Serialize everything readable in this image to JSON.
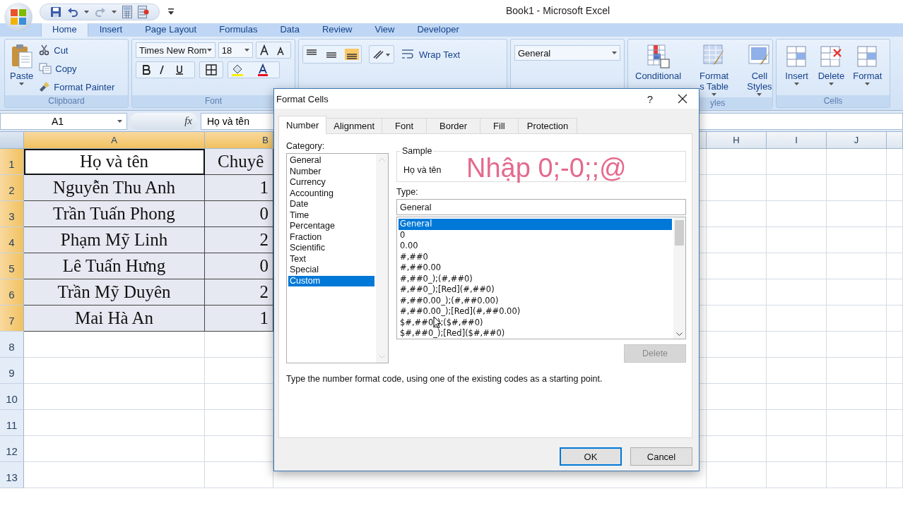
{
  "title_bar": {
    "title": "Book1 - Microsoft Excel"
  },
  "ribbon_tabs": [
    {
      "label": "Home",
      "selected": true
    },
    {
      "label": "Insert",
      "selected": false
    },
    {
      "label": "Page Layout",
      "selected": false
    },
    {
      "label": "Formulas",
      "selected": false
    },
    {
      "label": "Data",
      "selected": false
    },
    {
      "label": "Review",
      "selected": false
    },
    {
      "label": "View",
      "selected": false
    },
    {
      "label": "Developer",
      "selected": false
    }
  ],
  "ribbon": {
    "clipboard": {
      "paste": "Paste",
      "cut": "Cut",
      "copy": "Copy",
      "format_painter": "Format Painter",
      "label": "Clipboard"
    },
    "font": {
      "font_name": "Times New Rom",
      "font_size": "18",
      "label": "Font"
    },
    "alignment": {
      "wrap_text": "Wrap Text"
    },
    "number": {
      "format": "General"
    },
    "styles": {
      "conditional": "Conditional",
      "format_table": "Format",
      "format_table_2": "s Table",
      "cell_styles": "Cell",
      "cell_styles_2": "Styles",
      "label": "yles"
    },
    "cells": {
      "buttons": [
        "Insert",
        "Delete",
        "Format"
      ],
      "label": "Cells"
    }
  },
  "formula_bar": {
    "name_box": "A1",
    "function_label": "fx",
    "content": "Họ và tên"
  },
  "sheet": {
    "columns": [
      {
        "label": "A",
        "selected": true
      },
      {
        "label": "B",
        "selected": true
      },
      {
        "label": "H",
        "selected": false
      },
      {
        "label": "I",
        "selected": false
      },
      {
        "label": "J",
        "selected": false
      }
    ],
    "rows": [
      {
        "label": "1",
        "selected": true,
        "cells": [
          {
            "text": "Họ và tên",
            "active": true
          },
          {
            "text": "Chuyê",
            "active": false
          }
        ]
      },
      {
        "label": "2",
        "selected": true,
        "cells": [
          {
            "text": "Nguyễn Thu Anh",
            "active": false
          },
          {
            "text": "1",
            "active": false
          }
        ]
      },
      {
        "label": "3",
        "selected": true,
        "cells": [
          {
            "text": "Trần Tuấn Phong",
            "active": false
          },
          {
            "text": "0",
            "active": false
          }
        ]
      },
      {
        "label": "4",
        "selected": true,
        "cells": [
          {
            "text": "Phạm Mỹ Linh",
            "active": false
          },
          {
            "text": "2",
            "active": false
          }
        ]
      },
      {
        "label": "5",
        "selected": true,
        "cells": [
          {
            "text": "Lê Tuấn Hưng",
            "active": false
          },
          {
            "text": "0",
            "active": false
          }
        ]
      },
      {
        "label": "6",
        "selected": true,
        "cells": [
          {
            "text": "Trần Mỹ Duyên",
            "active": false
          },
          {
            "text": "2",
            "active": false
          }
        ]
      },
      {
        "label": "7",
        "selected": true,
        "cells": [
          {
            "text": "Mai Hà An",
            "active": false
          },
          {
            "text": "1",
            "active": false
          }
        ]
      },
      {
        "label": "8",
        "selected": false,
        "cells": []
      },
      {
        "label": "9",
        "selected": false,
        "cells": []
      },
      {
        "label": "10",
        "selected": false,
        "cells": []
      },
      {
        "label": "11",
        "selected": false,
        "cells": []
      },
      {
        "label": "12",
        "selected": false,
        "cells": []
      },
      {
        "label": "13",
        "selected": false,
        "cells": []
      }
    ]
  },
  "dialog": {
    "title": "Format Cells",
    "help": "?",
    "tabs": [
      {
        "label": "Number",
        "selected": true
      },
      {
        "label": "Alignment",
        "selected": false
      },
      {
        "label": "Font",
        "selected": false
      },
      {
        "label": "Border",
        "selected": false
      },
      {
        "label": "Fill",
        "selected": false
      },
      {
        "label": "Protection",
        "selected": false
      }
    ],
    "category_label": "Category:",
    "categories": [
      {
        "label": "General",
        "selected": false
      },
      {
        "label": "Number",
        "selected": false
      },
      {
        "label": "Currency",
        "selected": false
      },
      {
        "label": "Accounting",
        "selected": false
      },
      {
        "label": "Date",
        "selected": false
      },
      {
        "label": "Time",
        "selected": false
      },
      {
        "label": "Percentage",
        "selected": false
      },
      {
        "label": "Fraction",
        "selected": false
      },
      {
        "label": "Scientific",
        "selected": false
      },
      {
        "label": "Text",
        "selected": false
      },
      {
        "label": "Special",
        "selected": false
      },
      {
        "label": "Custom",
        "selected": true
      }
    ],
    "sample_label": "Sample",
    "sample_value": "Họ và tên",
    "annotation": "Nhập 0;-0;;@",
    "type_label": "Type:",
    "type_value": "General",
    "types": [
      {
        "label": "General",
        "selected": true
      },
      {
        "label": "0",
        "selected": false
      },
      {
        "label": "0.00",
        "selected": false
      },
      {
        "label": "#,##0",
        "selected": false
      },
      {
        "label": "#,##0.00",
        "selected": false
      },
      {
        "label": "#,##0_);(#,##0)",
        "selected": false
      },
      {
        "label": "#,##0_);[Red](#,##0)",
        "selected": false
      },
      {
        "label": "#,##0.00_);(#,##0.00)",
        "selected": false
      },
      {
        "label": "#,##0.00_);[Red](#,##0.00)",
        "selected": false
      },
      {
        "label": "$#,##0_);($#,##0)",
        "selected": false
      },
      {
        "label": "$#,##0_);[Red]($#,##0)",
        "selected": false
      }
    ],
    "delete_button": {
      "label": "Delete",
      "disabled": true
    },
    "hint": "Type the number format code, using one of the existing codes as a starting point.",
    "ok": "OK",
    "cancel": "Cancel"
  }
}
